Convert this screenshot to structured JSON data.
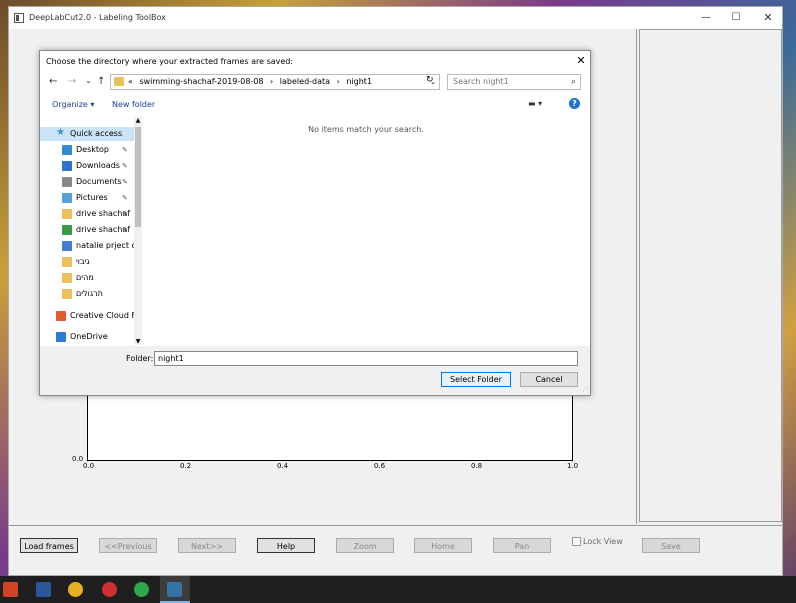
{
  "app": {
    "title": "DeepLabCut2.0 - Labeling ToolBox",
    "controls": {
      "minimize": "—",
      "maximize": "☐",
      "close": "✕"
    }
  },
  "plot": {
    "ytick": "0.0",
    "xticks": [
      "0.0",
      "0.2",
      "0.4",
      "0.6",
      "0.8",
      "1.0"
    ]
  },
  "toolbar": {
    "load_frames": "Load frames",
    "previous": "<<Previous",
    "next": "Next>>",
    "help": "Help",
    "zoom": "Zoom",
    "home": "Home",
    "pan": "Pan",
    "lock_view": "Lock View",
    "save": "Save"
  },
  "dialog": {
    "title": "Choose the directory where your extracted frames are saved:",
    "close": "✕",
    "nav": {
      "back": "←",
      "forward": "→",
      "recent": "⌄",
      "up": "↑"
    },
    "address": {
      "prefix": "«",
      "crumbs": [
        "swimming-shachaf-2019-08-08",
        "›",
        "labeled-data",
        "›",
        "night1"
      ],
      "dropdown": "⌄"
    },
    "refresh": "↻",
    "search": {
      "placeholder": "Search night1",
      "icon": "⌕"
    },
    "commands": {
      "organize": "Organize ▾",
      "new_folder": "New folder",
      "view": "▬ ▾",
      "help": "?"
    },
    "nav_items": [
      {
        "label": "Quick access",
        "icon": "star",
        "color": "#3d8fe0",
        "selected": true,
        "pinned": false
      },
      {
        "label": "Desktop",
        "icon": "desktop",
        "color": "#2f8ad8",
        "pinned": true
      },
      {
        "label": "Downloads",
        "icon": "download",
        "color": "#2f6fd0",
        "pinned": true
      },
      {
        "label": "Documents",
        "icon": "document",
        "color": "#888888",
        "pinned": true
      },
      {
        "label": "Pictures",
        "icon": "picture",
        "color": "#5aa0d8",
        "pinned": true
      },
      {
        "label": "drive shachaf",
        "icon": "folder",
        "color": "#e8c15a",
        "pinned": true
      },
      {
        "label": "drive shachaf",
        "icon": "gdrive",
        "color": "#3a9a4a",
        "pinned": true
      },
      {
        "label": "natalie prject div",
        "icon": "gdrive",
        "color": "#4a7ad8",
        "pinned": false
      },
      {
        "label": "גיבוי",
        "icon": "sync-folder",
        "color": "#e8c15a",
        "pinned": false
      },
      {
        "label": "מהים",
        "icon": "sync-folder",
        "color": "#e8c15a",
        "pinned": false
      },
      {
        "label": "תרגולים",
        "icon": "check-folder",
        "color": "#e8c15a",
        "pinned": false
      },
      {
        "label": "Creative Cloud Fil",
        "icon": "creative-cloud",
        "color": "#e05a30",
        "pinned": false
      },
      {
        "label": "OneDrive",
        "icon": "cloud",
        "color": "#2f7ad8",
        "pinned": false
      }
    ],
    "empty_message": "No items match your search.",
    "folder_label": "Folder:",
    "folder_value": "night1",
    "select_folder": "Select Folder",
    "cancel": "Cancel"
  },
  "taskbar": [
    {
      "name": "powerpoint",
      "color": "#d04423"
    },
    {
      "name": "word",
      "color": "#2b579a"
    },
    {
      "name": "chrome",
      "color": "#e8b020"
    },
    {
      "name": "app-red-ring",
      "color": "#d03030"
    },
    {
      "name": "app-green-ring",
      "color": "#2aa84a"
    },
    {
      "name": "python",
      "color": "#3572a5"
    }
  ]
}
